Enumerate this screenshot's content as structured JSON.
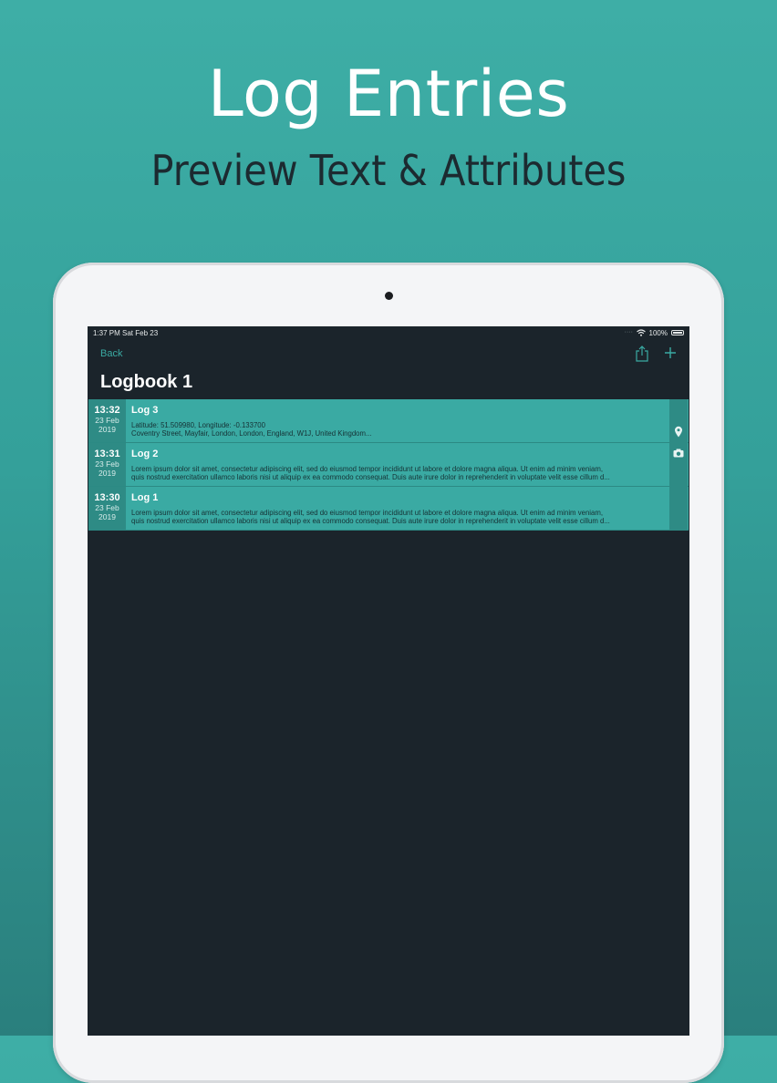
{
  "promo": {
    "title": "Log Entries",
    "subtitle": "Preview Text & Attributes"
  },
  "status_bar": {
    "time": "1:37 PM  Sat Feb 23",
    "battery": "100%"
  },
  "nav": {
    "back_label": "Back",
    "title": "Logbook 1"
  },
  "entries": [
    {
      "time": "13:32",
      "day": "23 Feb",
      "year": "2019",
      "title": "Log 3",
      "line1": "Latitude: 51.509980, Longitude: -0.133700",
      "line2": "Coventry Street, Mayfair, London, London, England, W1J, United Kingdom...",
      "attribute": "map-pin-icon"
    },
    {
      "time": "13:31",
      "day": "23 Feb",
      "year": "2019",
      "title": "Log 2",
      "line1": "Lorem ipsum dolor sit amet, consectetur adipiscing elit, sed do eiusmod tempor incididunt ut labore et dolore magna aliqua. Ut enim ad minim veniam,",
      "line2": "quis nostrud exercitation ullamco laboris nisi ut aliquip ex ea commodo consequat. Duis aute irure dolor in reprehenderit in voluptate velit esse cillum d...",
      "attribute": "camera-icon"
    },
    {
      "time": "13:30",
      "day": "23 Feb",
      "year": "2019",
      "title": "Log 1",
      "line1": "Lorem ipsum dolor sit amet, consectetur adipiscing elit, sed do eiusmod tempor incididunt ut labore et dolore magna aliqua. Ut enim ad minim veniam,",
      "line2": "quis nostrud exercitation ullamco laboris nisi ut aliquip ex ea commodo consequat. Duis aute irure dolor in reprehenderit in voluptate velit esse cillum d...",
      "attribute": ""
    }
  ],
  "colors": {
    "background_teal": "#3eaea6",
    "row_teal": "#3aaaa3",
    "date_teal": "#2e8b85",
    "screen_dark": "#1b242b"
  }
}
